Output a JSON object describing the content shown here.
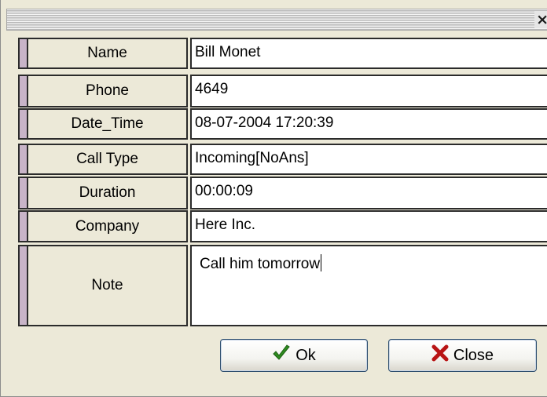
{
  "dialog": {
    "close_glyph": "×"
  },
  "fields": [
    {
      "label": "Name",
      "value": "Bill Monet"
    },
    {
      "label": "Phone",
      "value": "4649"
    },
    {
      "label": "Date_Time",
      "value": "08-07-2004 17:20:39"
    },
    {
      "label": "Call Type",
      "value": "Incoming[NoAns]"
    },
    {
      "label": "Duration",
      "value": "00:00:09"
    },
    {
      "label": "Company",
      "value": "Here Inc."
    },
    {
      "label": "Note",
      "value": "Call him tomorrow"
    }
  ],
  "buttons": {
    "ok_label": "Ok",
    "ok_icon": "checkmark-icon",
    "close_label": "Close",
    "close_icon": "red-x-icon"
  },
  "colors": {
    "dialog_bg": "#ece9d8",
    "marker": "#c8b4c8",
    "checkmark": "#2e8b1f",
    "close_x": "#b81414"
  }
}
